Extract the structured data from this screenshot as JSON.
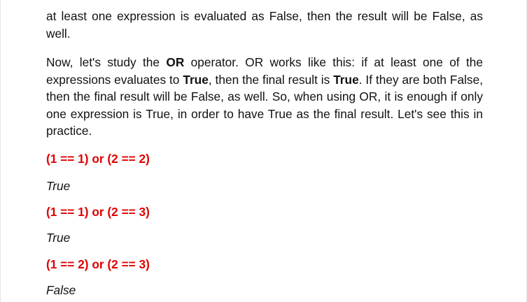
{
  "paragraphs": {
    "p1": "at least one expression is evaluated as False, then the result will be False, as well.",
    "p2": {
      "s1": "Now, let's study the ",
      "b1": "OR",
      "s2": " operator. OR works like this: if at least one of the expressions evaluates to ",
      "b2": "True",
      "s3": ", then the final result is ",
      "b3": "True",
      "s4": ". If they are both False, then the final result will be False, as well. So, when using OR, it is enough if only one expression is True, in order to have True as the final result. Let's see this in practice."
    }
  },
  "examples": [
    {
      "code": "(1 == 1) or (2 == 2)",
      "output": "True"
    },
    {
      "code": "(1 == 1) or (2 == 3)",
      "output": "True"
    },
    {
      "code": "(1 == 2) or (2 == 3)",
      "output": "False"
    }
  ],
  "colors": {
    "code_text": "#e00000",
    "body_text": "#111111",
    "background": "#ffffff"
  }
}
